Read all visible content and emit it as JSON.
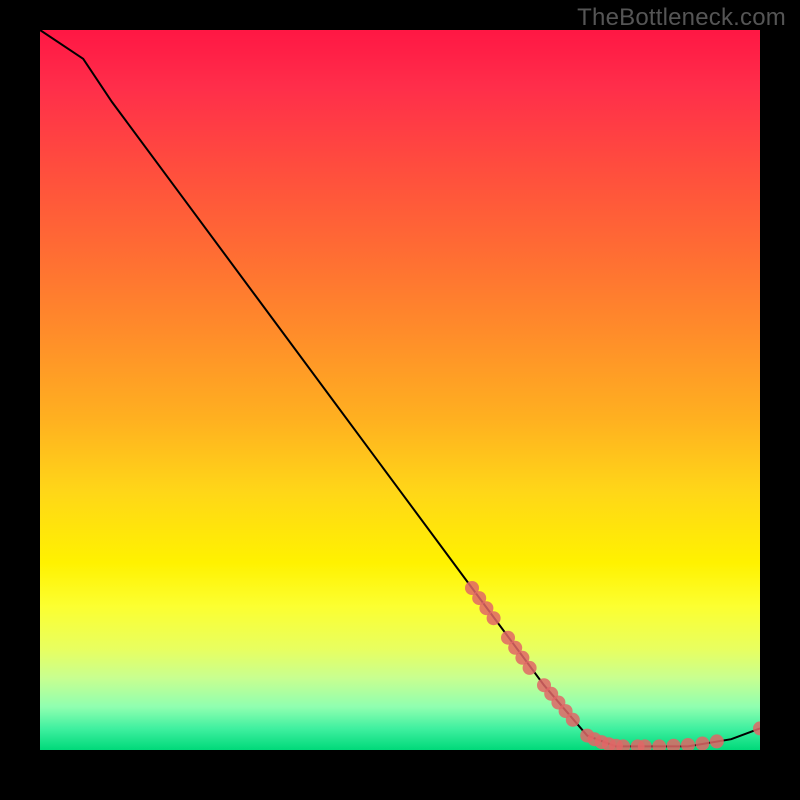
{
  "watermark": "TheBottleneck.com",
  "chart_data": {
    "type": "line",
    "title": "",
    "xlabel": "",
    "ylabel": "",
    "xlim": [
      0,
      100
    ],
    "ylim": [
      0,
      100
    ],
    "curve": [
      {
        "x": 0,
        "y": 100
      },
      {
        "x": 6,
        "y": 96
      },
      {
        "x": 10,
        "y": 90
      },
      {
        "x": 20,
        "y": 76.5
      },
      {
        "x": 30,
        "y": 63
      },
      {
        "x": 40,
        "y": 49.5
      },
      {
        "x": 50,
        "y": 36
      },
      {
        "x": 60,
        "y": 22.5
      },
      {
        "x": 70,
        "y": 9
      },
      {
        "x": 76,
        "y": 2
      },
      {
        "x": 80,
        "y": 0.5
      },
      {
        "x": 90,
        "y": 0.5
      },
      {
        "x": 96,
        "y": 1.5
      },
      {
        "x": 100,
        "y": 3
      }
    ],
    "scatter": [
      {
        "x": 60,
        "y": 22.5
      },
      {
        "x": 61,
        "y": 21.1
      },
      {
        "x": 62,
        "y": 19.7
      },
      {
        "x": 63,
        "y": 18.3
      },
      {
        "x": 65,
        "y": 15.6
      },
      {
        "x": 66,
        "y": 14.2
      },
      {
        "x": 67,
        "y": 12.8
      },
      {
        "x": 68,
        "y": 11.4
      },
      {
        "x": 70,
        "y": 9.0
      },
      {
        "x": 71,
        "y": 7.8
      },
      {
        "x": 72,
        "y": 6.6
      },
      {
        "x": 73,
        "y": 5.4
      },
      {
        "x": 74,
        "y": 4.2
      },
      {
        "x": 76,
        "y": 2.0
      },
      {
        "x": 77,
        "y": 1.5
      },
      {
        "x": 78,
        "y": 1.1
      },
      {
        "x": 79,
        "y": 0.8
      },
      {
        "x": 80,
        "y": 0.6
      },
      {
        "x": 81,
        "y": 0.5
      },
      {
        "x": 83,
        "y": 0.5
      },
      {
        "x": 84,
        "y": 0.5
      },
      {
        "x": 86,
        "y": 0.5
      },
      {
        "x": 88,
        "y": 0.6
      },
      {
        "x": 90,
        "y": 0.7
      },
      {
        "x": 92,
        "y": 0.9
      },
      {
        "x": 94,
        "y": 1.2
      },
      {
        "x": 100,
        "y": 3.0
      }
    ],
    "scatter_color": "#e06666",
    "curve_color": "#000000"
  }
}
